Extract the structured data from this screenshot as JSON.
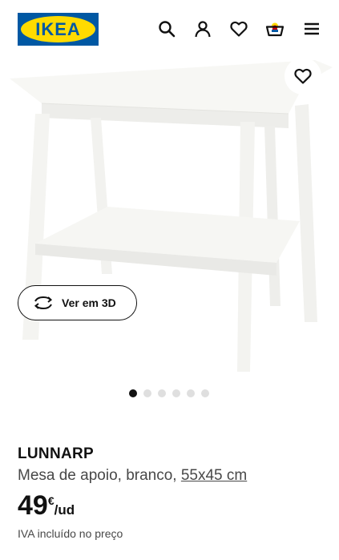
{
  "header": {
    "logo_text": "IKEA",
    "icons": [
      "search-icon",
      "user-icon",
      "heart-icon",
      "cart-icon",
      "menu-icon"
    ]
  },
  "colors": {
    "brand_blue": "#0058a3",
    "brand_yellow": "#ffdb00",
    "text_primary": "#111111",
    "text_secondary": "#484848",
    "dot_inactive": "#dfdfdf"
  },
  "gallery": {
    "view_3d_label": "Ver em 3D",
    "dot_count": 6,
    "active_dot": 1
  },
  "product": {
    "name": "LUNNARP",
    "description": "Mesa de apoio, branco, ",
    "size": "55x45 cm",
    "price": "49",
    "currency": "€",
    "unit": "/ud",
    "vat_note": "IVA incluído no preço"
  }
}
